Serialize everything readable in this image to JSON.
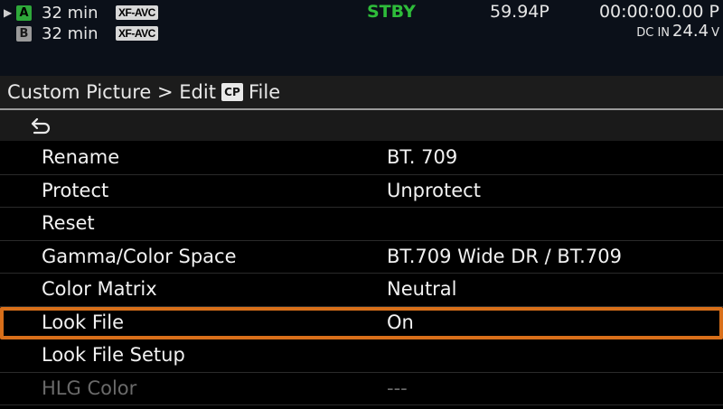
{
  "status": {
    "slot_a": {
      "letter": "A",
      "time": "32 min",
      "codec": "XF-AVC",
      "arrow": "▶"
    },
    "slot_b": {
      "letter": "B",
      "time": "32 min",
      "codec": "XF-AVC"
    },
    "mode": "STBY",
    "frame_rate": "59.94P",
    "timecode": "00:00:00.00 P",
    "power": {
      "label": "DC IN",
      "value": "24.4",
      "unit": "V"
    },
    "colors": {
      "active_slot": "#2ea83a",
      "stby": "#2ebc3a"
    }
  },
  "menu": {
    "breadcrumb_prefix": "Custom Picture > Edit",
    "cp_badge": "CP",
    "breadcrumb_suffix": "File",
    "back_icon": "return-arrow-icon",
    "items": [
      {
        "label": "Rename",
        "value": "BT. 709"
      },
      {
        "label": "Protect",
        "value": "Unprotect"
      },
      {
        "label": "Reset",
        "value": ""
      },
      {
        "label": "Gamma/Color Space",
        "value": "BT.709 Wide DR / BT.709"
      },
      {
        "label": "Color Matrix",
        "value": "Neutral"
      },
      {
        "label": "Look File",
        "value": "On",
        "selected": true
      },
      {
        "label": "Look File Setup",
        "value": ""
      },
      {
        "label": "HLG Color",
        "value": "---",
        "disabled": true
      }
    ],
    "highlight_color": "#d86f1a"
  }
}
